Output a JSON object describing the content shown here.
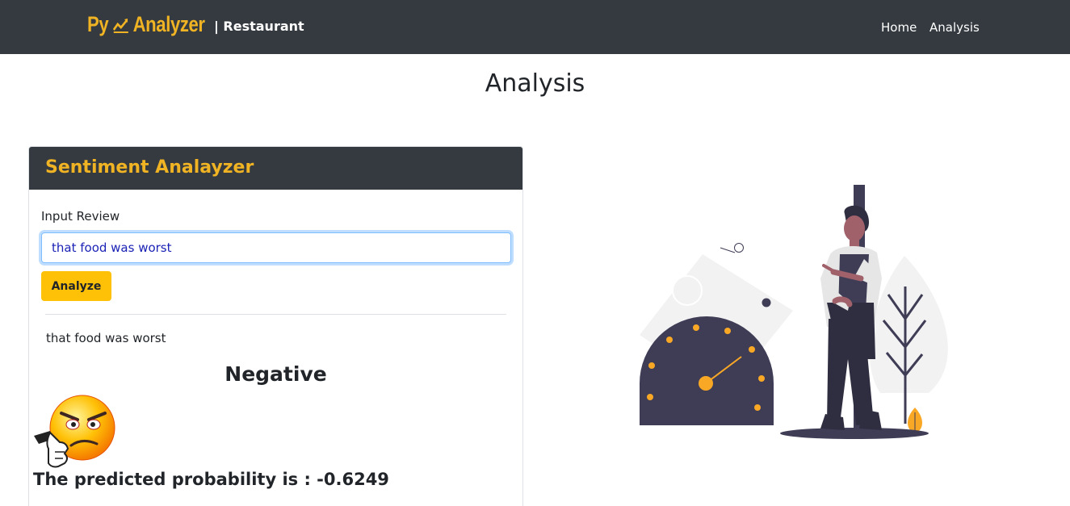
{
  "navbar": {
    "logo_text": "Py 📈 Analyzer",
    "brand_sub": "| Restaurant",
    "links": [
      "Home",
      "Analysis"
    ]
  },
  "page": {
    "title": "Analysis"
  },
  "card": {
    "title": "Sentiment Analayzer",
    "input_label": "Input Review",
    "input_value": "that food was worst",
    "analyze_label": "Analyze",
    "echo_text": "that food was worst",
    "sentiment": "Negative",
    "probability_text": "The predicted probability is : -0.6249"
  },
  "colors": {
    "navbar_bg": "#343a40",
    "accent": "#f0b323",
    "button": "#ffc107",
    "illustration_dark": "#3f3d56",
    "illustration_orange": "#f9a826"
  },
  "icons": [
    "chart-line-icon",
    "angry-thumbs-down-emoji",
    "speedometer-person-illustration"
  ]
}
